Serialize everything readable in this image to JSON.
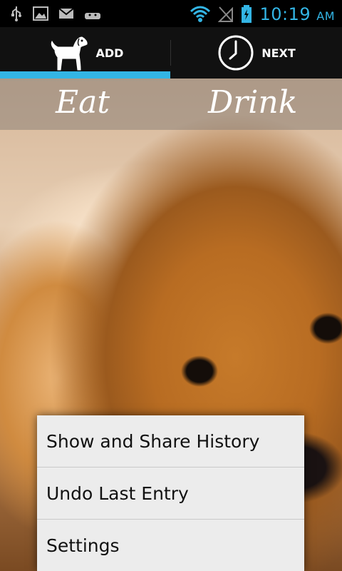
{
  "status_bar": {
    "time": "10:19",
    "ampm": "AM",
    "icons": [
      "usb-icon",
      "image-icon",
      "mail-icon",
      "android-icon",
      "wifi-icon",
      "signal-icon",
      "battery-charging-icon"
    ],
    "accent_color": "#33b5e5"
  },
  "tabs": [
    {
      "label": "ADD",
      "icon": "dog-icon",
      "selected": true
    },
    {
      "label": "NEXT",
      "icon": "clock-icon",
      "selected": false
    }
  ],
  "labels": {
    "eat": "Eat",
    "drink": "Drink"
  },
  "menu": {
    "items": [
      {
        "label": "Show and Share History"
      },
      {
        "label": "Undo Last Entry"
      },
      {
        "label": "Settings"
      }
    ]
  }
}
